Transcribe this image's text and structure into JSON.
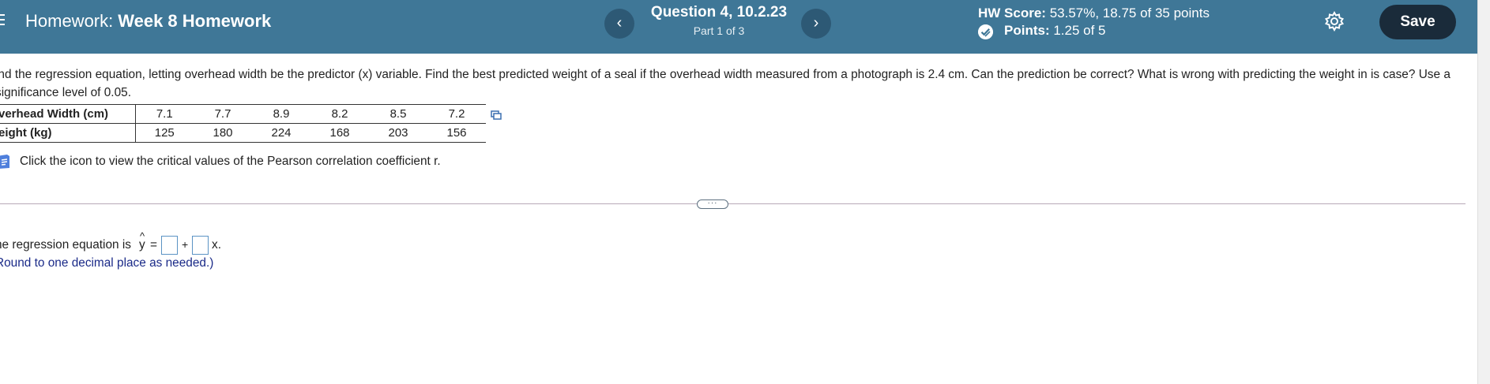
{
  "header": {
    "title_prefix": "Homework:",
    "title_name": "Week 8 Homework",
    "question_title": "Question 4, 10.2.23",
    "question_part": "Part 1 of 3",
    "prev_label": "‹",
    "next_label": "›",
    "hw_score_label": "HW Score:",
    "hw_score_value": "53.57%, 18.75 of 35 points",
    "points_label": "Points:",
    "points_value": "1.25 of 5",
    "save_label": "Save",
    "colors": {
      "bar": "#3f7797",
      "nav_button": "#2d5975",
      "save_button": "#1a2b3a"
    }
  },
  "problem": {
    "text": "ind the regression equation, letting overhead width be the predictor (x) variable. Find the best predicted weight of a seal if the overhead width measured from a photograph is 2.4 cm. Can the prediction be correct? What is wrong with predicting the weight in is case? Use a significance level of 0.05.",
    "table": {
      "rows": [
        {
          "label": "verhead Width (cm)",
          "values": [
            "7.1",
            "7.7",
            "8.9",
            "8.2",
            "8.5",
            "7.2"
          ]
        },
        {
          "label": "eight (kg)",
          "values": [
            "125",
            "180",
            "224",
            "168",
            "203",
            "156"
          ]
        }
      ]
    },
    "critical_values_text": "Click the icon to view the critical values of the Pearson correlation coefficient r."
  },
  "more_button_label": "···",
  "answer": {
    "prefix": "he regression equation is",
    "yhat": "y",
    "hat": "^",
    "equals": "=",
    "plus": "+",
    "x_var": "x.",
    "box1_value": "",
    "box2_value": "",
    "round_note": "Round to one decimal place as needed.)"
  },
  "icons": {
    "menu": "menu-icon",
    "prev": "chevron-left-icon",
    "next": "chevron-right-icon",
    "points": "partial-credit-icon",
    "settings": "gear-icon",
    "copy": "copy-data-icon",
    "critical": "book-icon"
  }
}
